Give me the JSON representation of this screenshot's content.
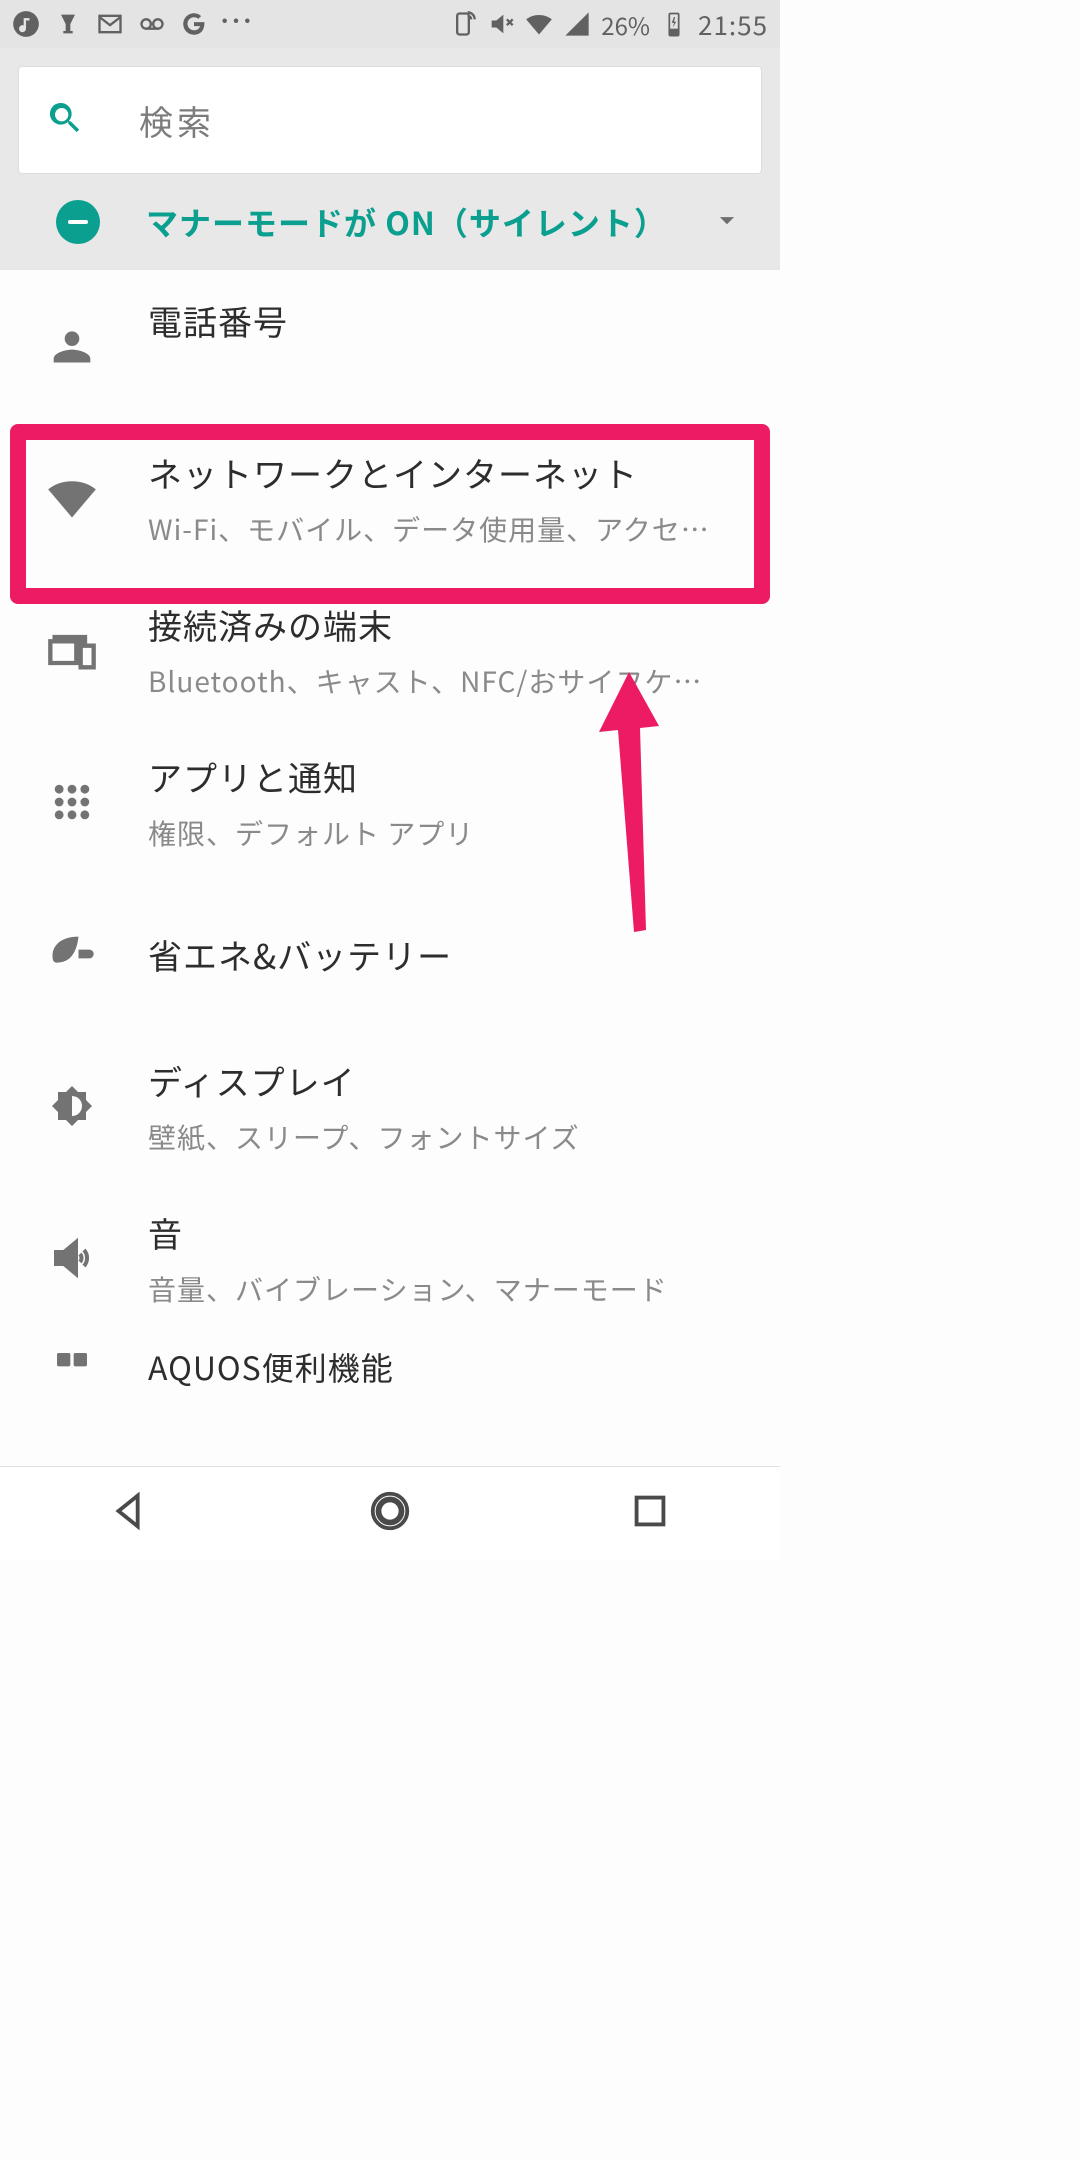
{
  "statusbar": {
    "battery_pct": "26%",
    "clock": "21:55"
  },
  "search": {
    "placeholder": "検索"
  },
  "banner": {
    "text": "マナーモードが ON（サイレント）"
  },
  "rows": {
    "phone": {
      "title": "電話番号",
      "sub": "　"
    },
    "network": {
      "title": "ネットワークとインターネット",
      "sub": "Wi-Fi、モバイル、データ使用量、アクセ…"
    },
    "devices": {
      "title": "接続済みの端末",
      "sub": "Bluetooth、キャスト、NFC/おサイフケ…"
    },
    "apps": {
      "title": "アプリと通知",
      "sub": "権限、デフォルト アプリ"
    },
    "battery": {
      "title": "省エネ&バッテリー",
      "sub": ""
    },
    "display": {
      "title": "ディスプレイ",
      "sub": "壁紙、スリープ、フォントサイズ"
    },
    "sound": {
      "title": "音",
      "sub": "音量、バイブレーション、マナーモード"
    },
    "aquos": {
      "title": "AQUOS便利機能",
      "sub": ""
    }
  }
}
